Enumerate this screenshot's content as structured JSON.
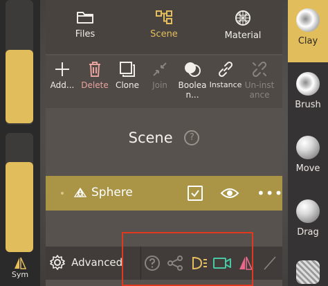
{
  "tabs": [
    {
      "label": "Files",
      "icon": "folder-icon"
    },
    {
      "label": "Scene",
      "icon": "scene-graph-icon",
      "active": true
    },
    {
      "label": "Material",
      "icon": "material-sphere-icon"
    }
  ],
  "actions": {
    "add": "Add...",
    "delete": "Delete",
    "clone": "Clone",
    "join": "Join",
    "boolean_line1": "Boolea",
    "boolean_line2": "n...",
    "instance": "Instance",
    "uninstance_line1": "Un-inst",
    "uninstance_line2": "ance"
  },
  "scene": {
    "title": "Scene",
    "help_glyph": "?"
  },
  "object_row": {
    "name": "Sphere",
    "more_glyph": "•••",
    "visible": true,
    "checked": true
  },
  "bottom_bar": {
    "advanced_label": "Advanced",
    "icons": [
      "help-icon",
      "share-icon",
      "light-icon",
      "camera-icon",
      "symmetry-icon",
      "slash-icon"
    ]
  },
  "left_panel": {
    "sym_label": "Sym"
  },
  "tools": [
    {
      "label": "Clay",
      "active": true
    },
    {
      "label": "Brush"
    },
    {
      "label": "Move"
    },
    {
      "label": "Drag"
    }
  ],
  "colors": {
    "accent": "#e5bf5e",
    "row_highlight": "#aa9547",
    "delete": "#e8a39f",
    "camera": "#48c9a6",
    "symmetry": "#e86a8a",
    "highlight_box": "#e2381f"
  }
}
